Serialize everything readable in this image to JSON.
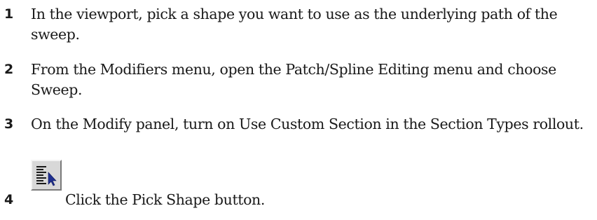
{
  "steps": [
    {
      "number": "1",
      "text": "In the viewport, pick a shape you want to use as the underlying path of the sweep."
    },
    {
      "number": "2",
      "text": "From the Modifiers menu, open the Patch/Spline Editing menu and choose Sweep."
    },
    {
      "number": "3",
      "text": "On the Modify panel, turn on Use Custom Section in the Section Types rollout."
    },
    {
      "number": "4",
      "text": "Click the Pick Shape button."
    }
  ],
  "pick_shape_button": {
    "icon": "pick-shape-icon",
    "face_color": "#d8d8d8",
    "arrow_color": "#1f2f8f"
  }
}
